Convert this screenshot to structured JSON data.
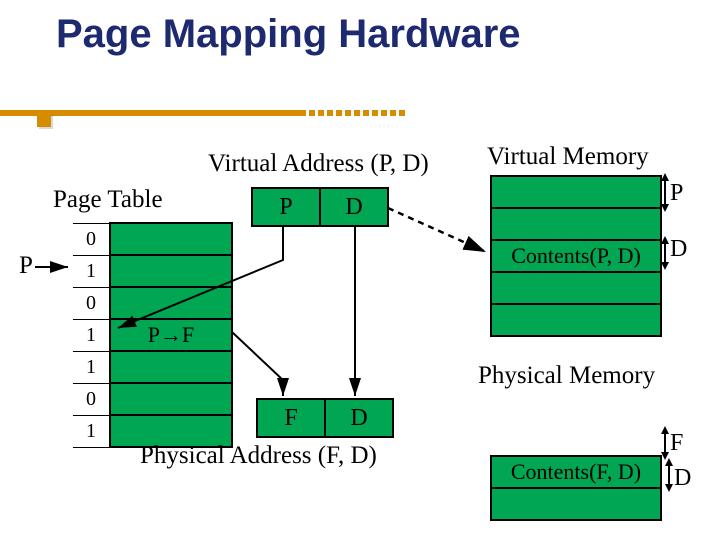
{
  "title": "Page Mapping Hardware",
  "labels": {
    "virtual_address": "Virtual Address (P, D)",
    "virtual_memory": "Virtual Memory",
    "page_table": "Page Table",
    "p_marker": "P",
    "d_marker": "D",
    "pf_mapping": "P→F",
    "contents_pd": "Contents(P, D)",
    "physical_memory": "Physical Memory",
    "f_marker": "F",
    "physical_address": "Physical Address (F, D)",
    "contents_fd": "Contents(F, D)"
  },
  "page_table_indices": [
    "0",
    "1",
    "0",
    "1",
    "1",
    "0",
    "1"
  ],
  "addr_top": {
    "p": "P",
    "d": "D"
  },
  "addr_bottom": {
    "f": "F",
    "d": "D"
  },
  "mem_rows_count": 5
}
